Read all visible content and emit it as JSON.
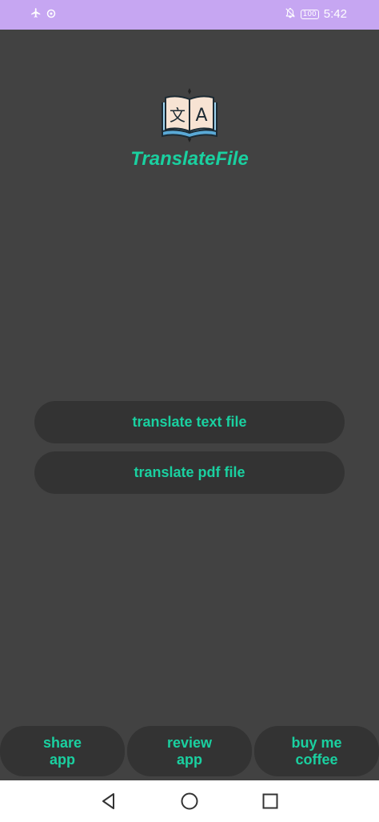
{
  "status_bar": {
    "airplane_icon": "airplane-icon",
    "data_icon": "data-saver-icon",
    "mute_icon": "notifications-off-icon",
    "battery": "100",
    "time": "5:42"
  },
  "app": {
    "title": "TranslateFile",
    "logo_icon": "translate-book-icon",
    "logo_glyph_left": "文",
    "logo_glyph_right": "A"
  },
  "main": {
    "translate_text_label": "translate text file",
    "translate_pdf_label": "translate pdf file"
  },
  "bottom": {
    "share_line1": "share",
    "share_line2": "app",
    "review_line1": "review",
    "review_line2": "app",
    "coffee_line1": "buy me",
    "coffee_line2": "coffee"
  },
  "nav": {
    "back_icon": "back-triangle-icon",
    "home_icon": "home-circle-icon",
    "recent_icon": "recent-apps-square-icon"
  },
  "colors": {
    "background": "#424242",
    "button": "#333333",
    "accent": "#1ad0a0",
    "status_bar": "#c6a6f2"
  }
}
